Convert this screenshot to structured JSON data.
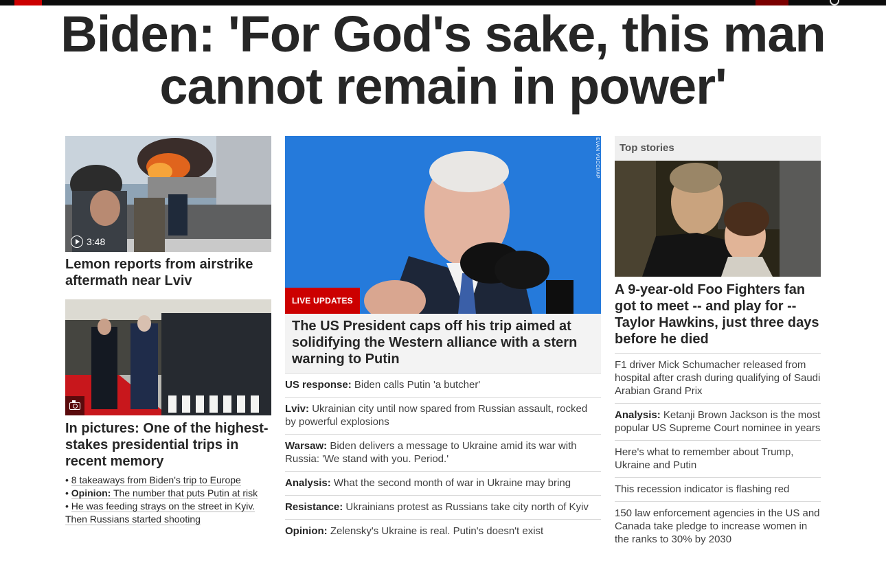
{
  "headline": "Biden: 'For God's sake, this man cannot remain in power'",
  "left": {
    "video_duration": "3:48",
    "story1_title": "Lemon reports from airstrike aftermath near Lviv",
    "story2_title": "In pictures: One of the highest-stakes presidential trips in recent memory",
    "bullets": [
      {
        "prefix": "",
        "text": "8 takeaways from Biden's trip to Europe"
      },
      {
        "prefix": "Opinion:",
        "text": "The number that puts Putin at risk"
      },
      {
        "prefix": "",
        "text": "He was feeding strays on the street in Kyiv. Then Russians started shooting"
      }
    ]
  },
  "middle": {
    "badge": "LIVE UPDATES",
    "photo_credit": "EVAN VUCCI/AP",
    "title": "The US President caps off his trip aimed at solidifying the Western alliance with a stern warning to Putin",
    "links": [
      {
        "prefix": "US response:",
        "text": "Biden calls Putin 'a butcher'"
      },
      {
        "prefix": "Lviv:",
        "text": "Ukrainian city until now spared from Russian assault, rocked by powerful explosions"
      },
      {
        "prefix": "Warsaw:",
        "text": "Biden delivers a message to Ukraine amid its war with Russia: 'We stand with you. Period.'"
      },
      {
        "prefix": "Analysis:",
        "text": "What the second month of war in Ukraine may bring"
      },
      {
        "prefix": "Resistance:",
        "text": "Ukrainians protest as Russians take city north of Kyiv"
      },
      {
        "prefix": "Opinion:",
        "text": "Zelensky's Ukraine is real. Putin's doesn't exist"
      }
    ]
  },
  "right": {
    "section_title": "Top stories",
    "title": "A 9-year-old Foo Fighters fan got to meet -- and play for -- Taylor Hawkins, just three days before he died",
    "links": [
      {
        "prefix": "",
        "text": "F1 driver Mick Schumacher released from hospital after crash during qualifying of Saudi Arabian Grand Prix"
      },
      {
        "prefix": "Analysis:",
        "text": "Ketanji Brown Jackson is the most popular US Supreme Court nominee in years"
      },
      {
        "prefix": "",
        "text": "Here's what to remember about Trump, Ukraine and Putin"
      },
      {
        "prefix": "",
        "text": "This recession indicator is flashing red"
      },
      {
        "prefix": "",
        "text": "150 law enforcement agencies in the US and Canada take pledge to increase women in the ranks to 30% by 2030"
      }
    ]
  },
  "colors": {
    "brand_red": "#cc0000",
    "text": "#262626"
  }
}
